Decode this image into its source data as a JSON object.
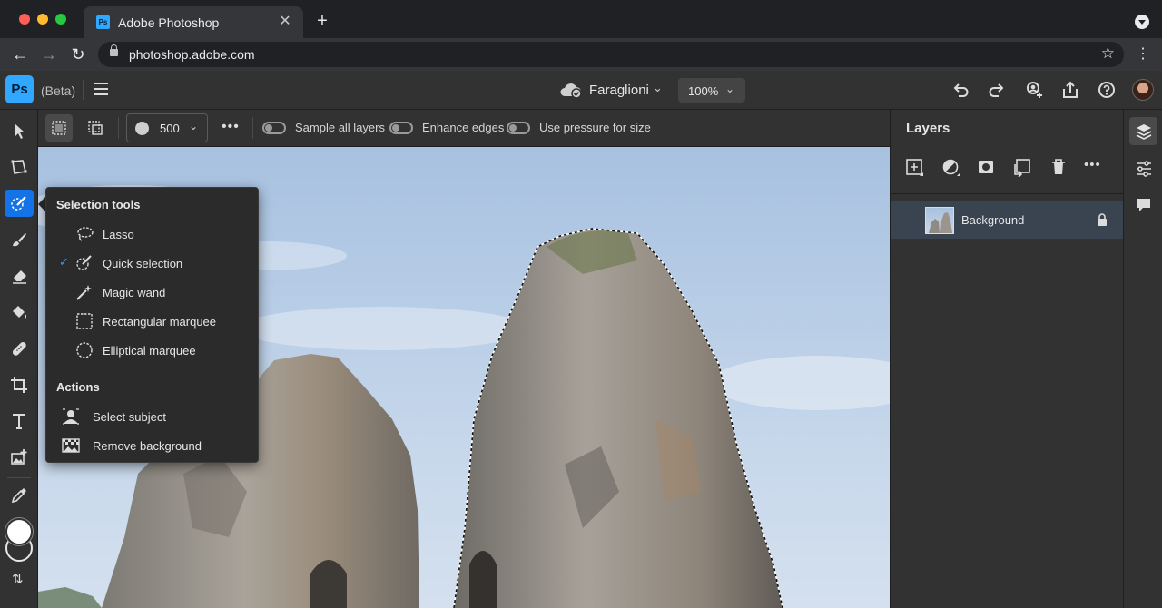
{
  "browser": {
    "tab_title": "Adobe Photoshop",
    "tab_favicon": "Ps",
    "url": "photoshop.adobe.com"
  },
  "app": {
    "logo": "Ps",
    "beta_label": "(Beta)",
    "document_name": "Faraglioni",
    "zoom": "100%"
  },
  "options": {
    "brush_size": "500",
    "toggles": [
      {
        "label": "Sample all layers",
        "on": false
      },
      {
        "label": "Enhance edges",
        "on": false
      },
      {
        "label": "Use pressure for size",
        "on": false
      }
    ]
  },
  "flyout": {
    "selection_heading": "Selection tools",
    "selection_items": [
      {
        "label": "Lasso",
        "icon": "lasso-icon",
        "checked": false
      },
      {
        "label": "Quick selection",
        "icon": "quick-selection-icon",
        "checked": true
      },
      {
        "label": "Magic wand",
        "icon": "magic-wand-icon",
        "checked": false
      },
      {
        "label": "Rectangular marquee",
        "icon": "rectangular-marquee-icon",
        "checked": false
      },
      {
        "label": "Elliptical marquee",
        "icon": "elliptical-marquee-icon",
        "checked": false
      }
    ],
    "actions_heading": "Actions",
    "action_items": [
      {
        "label": "Select subject",
        "icon": "select-subject-icon"
      },
      {
        "label": "Remove background",
        "icon": "remove-background-icon"
      }
    ]
  },
  "layers_panel": {
    "title": "Layers",
    "layers": [
      {
        "name": "Background",
        "locked": true
      }
    ]
  },
  "colors": {
    "accent": "#1473e6",
    "foreground_color": "#ffffff",
    "background_color": "#323232"
  }
}
